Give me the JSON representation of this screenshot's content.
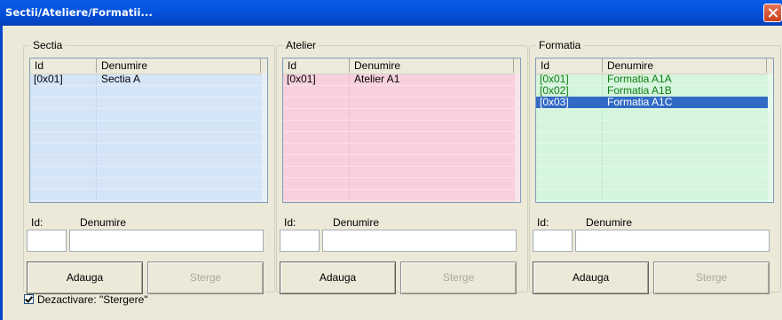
{
  "window": {
    "title": "Sectii/Ateliere/Formatii..."
  },
  "columns": {
    "id": "Id",
    "name": "Denumire"
  },
  "form_labels": {
    "id": "Id:",
    "name": "Denumire"
  },
  "buttons": {
    "add": "Adauga",
    "delete": "Sterge"
  },
  "colors": {
    "sectia_bg": "#d5e5f8",
    "atelier_bg": "#f8d0dd",
    "formatia_bg": "#d5f5dc",
    "selection": "#316ac5",
    "formatia_text": "#0e7e15"
  },
  "groups": [
    {
      "title": "Sectia",
      "rows": [
        {
          "id": "[0x01]",
          "name": "Sectia A"
        }
      ]
    },
    {
      "title": "Atelier",
      "rows": [
        {
          "id": "[0x01]",
          "name": "Atelier A1"
        }
      ]
    },
    {
      "title": "Formatia",
      "rows": [
        {
          "id": "[0x01]",
          "name": "Formatia A1A"
        },
        {
          "id": "[0x02]",
          "name": "Formatia A1B"
        },
        {
          "id": "[0x03]",
          "name": "Formatia A1C",
          "selected": true
        }
      ]
    }
  ],
  "checkbox": {
    "label": "Dezactivare: \"Stergere\"",
    "checked": true
  }
}
